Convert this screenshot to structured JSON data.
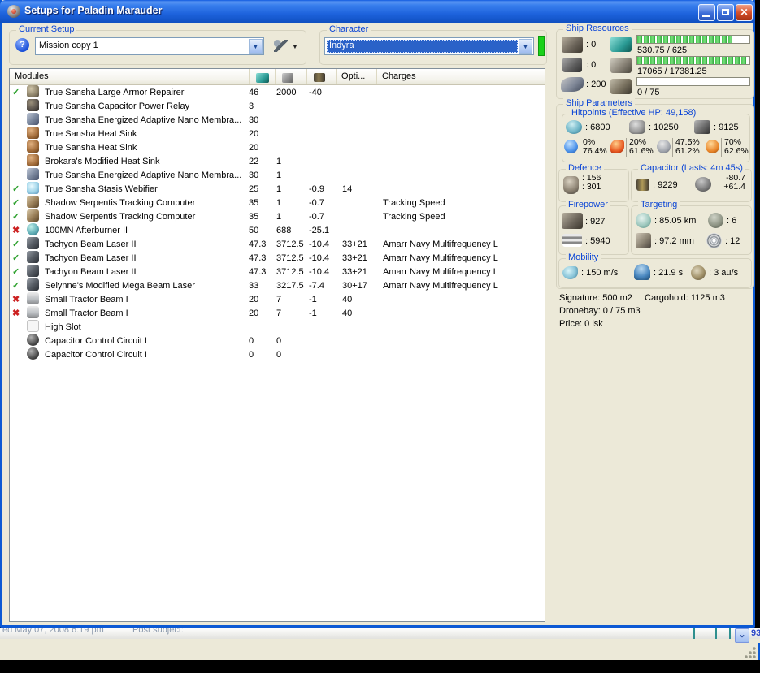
{
  "window": {
    "title": "Setups for Paladin Marauder"
  },
  "setup": {
    "group_label": "Current Setup",
    "value": "Mission copy 1"
  },
  "character": {
    "group_label": "Character",
    "value": "Indyra"
  },
  "modules_table": {
    "name_header": "Modules",
    "opti_header": "Opti...",
    "charges_header": "Charges",
    "rows": [
      {
        "status": "ok",
        "icon": "repairer",
        "name": "True Sansha Large Armor Repairer",
        "cpu": "46",
        "pg": "2000",
        "cap": "-40",
        "opti": "",
        "charges": ""
      },
      {
        "status": "",
        "icon": "relay",
        "name": "True Sansha Capacitor Power Relay",
        "cpu": "3",
        "pg": "",
        "cap": "",
        "opti": "",
        "charges": ""
      },
      {
        "status": "",
        "icon": "membrane",
        "name": "True Sansha Energized Adaptive Nano Membra...",
        "cpu": "30",
        "pg": "",
        "cap": "",
        "opti": "",
        "charges": ""
      },
      {
        "status": "",
        "icon": "heatsink",
        "name": "True Sansha Heat Sink",
        "cpu": "20",
        "pg": "",
        "cap": "",
        "opti": "",
        "charges": ""
      },
      {
        "status": "",
        "icon": "heatsink",
        "name": "True Sansha Heat Sink",
        "cpu": "20",
        "pg": "",
        "cap": "",
        "opti": "",
        "charges": ""
      },
      {
        "status": "",
        "icon": "heatsink",
        "name": "Brokara's Modified Heat Sink",
        "cpu": "22",
        "pg": "1",
        "cap": "",
        "opti": "",
        "charges": ""
      },
      {
        "status": "",
        "icon": "membrane",
        "name": "True Sansha Energized Adaptive Nano Membra...",
        "cpu": "30",
        "pg": "1",
        "cap": "",
        "opti": "",
        "charges": ""
      },
      {
        "status": "ok",
        "icon": "web",
        "name": "True Sansha Stasis Webifier",
        "cpu": "25",
        "pg": "1",
        "cap": "-0.9",
        "opti": "14",
        "charges": ""
      },
      {
        "status": "ok",
        "icon": "tc",
        "name": "Shadow Serpentis Tracking Computer",
        "cpu": "35",
        "pg": "1",
        "cap": "-0.7",
        "opti": "",
        "charges": "Tracking Speed"
      },
      {
        "status": "ok",
        "icon": "tc",
        "name": "Shadow Serpentis Tracking Computer",
        "cpu": "35",
        "pg": "1",
        "cap": "-0.7",
        "opti": "",
        "charges": "Tracking Speed"
      },
      {
        "status": "no",
        "icon": "ab",
        "name": "100MN Afterburner II",
        "cpu": "50",
        "pg": "688",
        "cap": "-25.1",
        "opti": "",
        "charges": ""
      },
      {
        "status": "ok",
        "icon": "laser",
        "name": "Tachyon Beam Laser II",
        "cpu": "47.3",
        "pg": "3712.5",
        "cap": "-10.4",
        "opti": "33+21",
        "charges": "Amarr Navy Multifrequency L"
      },
      {
        "status": "ok",
        "icon": "laser",
        "name": "Tachyon Beam Laser II",
        "cpu": "47.3",
        "pg": "3712.5",
        "cap": "-10.4",
        "opti": "33+21",
        "charges": "Amarr Navy Multifrequency L"
      },
      {
        "status": "ok",
        "icon": "laser",
        "name": "Tachyon Beam Laser II",
        "cpu": "47.3",
        "pg": "3712.5",
        "cap": "-10.4",
        "opti": "33+21",
        "charges": "Amarr Navy Multifrequency L"
      },
      {
        "status": "ok",
        "icon": "laser",
        "name": "Selynne's Modified Mega Beam Laser",
        "cpu": "33",
        "pg": "3217.5",
        "cap": "-7.4",
        "opti": "30+17",
        "charges": "Amarr Navy Multifrequency L"
      },
      {
        "status": "no",
        "icon": "tractor",
        "name": "Small Tractor Beam I",
        "cpu": "20",
        "pg": "7",
        "cap": "-1",
        "opti": "40",
        "charges": ""
      },
      {
        "status": "no",
        "icon": "tractor",
        "name": "Small Tractor Beam I",
        "cpu": "20",
        "pg": "7",
        "cap": "-1",
        "opti": "40",
        "charges": ""
      },
      {
        "status": "",
        "icon": "slot",
        "name": "High Slot",
        "cpu": "",
        "pg": "",
        "cap": "",
        "opti": "",
        "charges": ""
      },
      {
        "status": "",
        "icon": "rig",
        "name": "Capacitor Control Circuit I",
        "cpu": "0",
        "pg": "0",
        "cap": "",
        "opti": "",
        "charges": ""
      },
      {
        "status": "",
        "icon": "rig",
        "name": "Capacitor Control Circuit I",
        "cpu": "0",
        "pg": "0",
        "cap": "",
        "opti": "",
        "charges": ""
      }
    ]
  },
  "ship_resources": {
    "label": "Ship Resources",
    "turret_slots": "0",
    "launcher_slots": "0",
    "calibration": "200",
    "cpu_bar": {
      "text": "530.75 / 625",
      "pct": 85
    },
    "pg_bar": {
      "text": "17065 / 17381.25",
      "pct": 98
    },
    "drone_bar": {
      "text": "0 / 75",
      "pct": 0
    }
  },
  "ship_parameters": {
    "label": "Ship Parameters",
    "hitpoints": {
      "label": "Hitpoints (Effective HP: 49,158)",
      "shield": "6800",
      "armor": "10250",
      "structure": "9125",
      "resists": [
        {
          "top": "0%",
          "bottom": "76.4%"
        },
        {
          "top": "20%",
          "bottom": "61.6%"
        },
        {
          "top": "47.5%",
          "bottom": "61.2%"
        },
        {
          "top": "70%",
          "bottom": "62.6%"
        }
      ]
    },
    "defence": {
      "label": "Defence",
      "v1": "156",
      "v2": "301"
    },
    "capacitor": {
      "label": "Capacitor (Lasts: 4m 45s)",
      "amount": "9229",
      "drain": "-80.7",
      "recharge": "+61.4"
    },
    "firepower": {
      "label": "Firepower",
      "dps": "927",
      "volley": "5940"
    },
    "targeting": {
      "label": "Targeting",
      "range": "85.05 km",
      "max_targets": "6",
      "scan_res": "97.2 mm",
      "sig_radius": "12"
    },
    "mobility": {
      "label": "Mobility",
      "speed": "150 m/s",
      "align": "21.9 s",
      "warp": "3 au/s"
    },
    "info": {
      "signature": "Signature: 500 m2",
      "cargohold": "Cargohold: 1125 m3",
      "dronebay": "Dronebay: 0 / 75 m3",
      "price": "Price: 0 isk"
    }
  },
  "background": {
    "post_date": "ed May 07, 2008 6:19 pm",
    "post_subject": "Post subject:",
    "fragment": "93",
    "scroll_arrow": "v"
  }
}
